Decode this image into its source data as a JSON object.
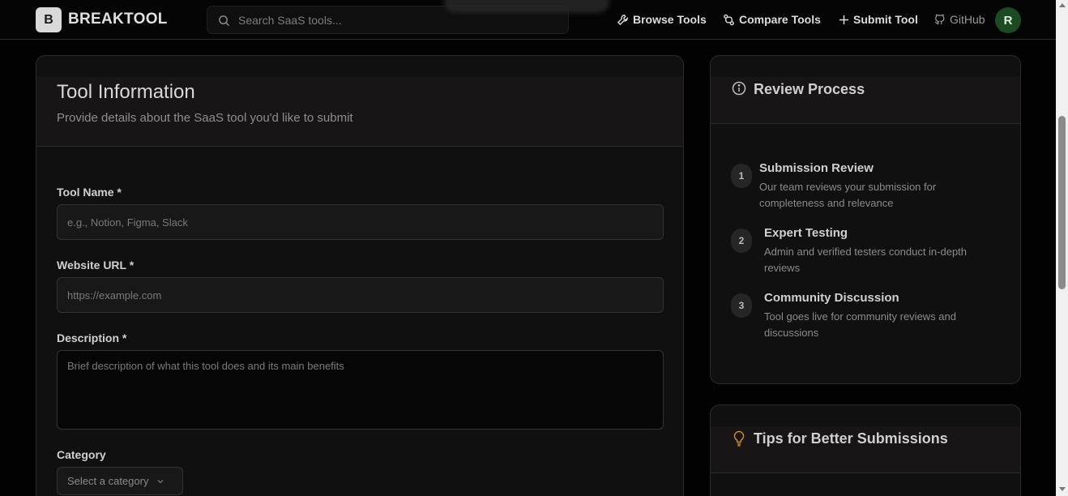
{
  "header": {
    "logo_letter": "B",
    "brand": "BREAKTOOL",
    "search_placeholder": "Search SaaS tools...",
    "nav": {
      "browse": "Browse Tools",
      "compare": "Compare Tools",
      "submit": "Submit Tool",
      "github": "GitHub"
    },
    "avatar_letter": "R"
  },
  "form": {
    "title": "Tool Information",
    "subtitle": "Provide details about the SaaS tool you'd like to submit",
    "tool_name_label": "Tool Name *",
    "tool_name_placeholder": "e.g., Notion, Figma, Slack",
    "website_label": "Website URL *",
    "website_placeholder": "https://example.com",
    "description_label": "Description *",
    "description_placeholder": "Brief description of what this tool does and its main benefits",
    "category_label": "Category",
    "category_placeholder": "Select a category"
  },
  "review": {
    "title": "Review Process",
    "steps": [
      {
        "num": "1",
        "title": "Submission Review",
        "desc": "Our team reviews your submission for completeness and relevance"
      },
      {
        "num": "2",
        "title": "Expert Testing",
        "desc": "Admin and verified testers conduct in-depth reviews"
      },
      {
        "num": "3",
        "title": "Community Discussion",
        "desc": "Tool goes live for community reviews and discussions"
      }
    ]
  },
  "tips": {
    "title": "Tips for Better Submissions"
  },
  "colors": {
    "background": "#020202",
    "card": "#111010",
    "avatar": "#1c4a23",
    "tip_icon": "#c9892f"
  }
}
